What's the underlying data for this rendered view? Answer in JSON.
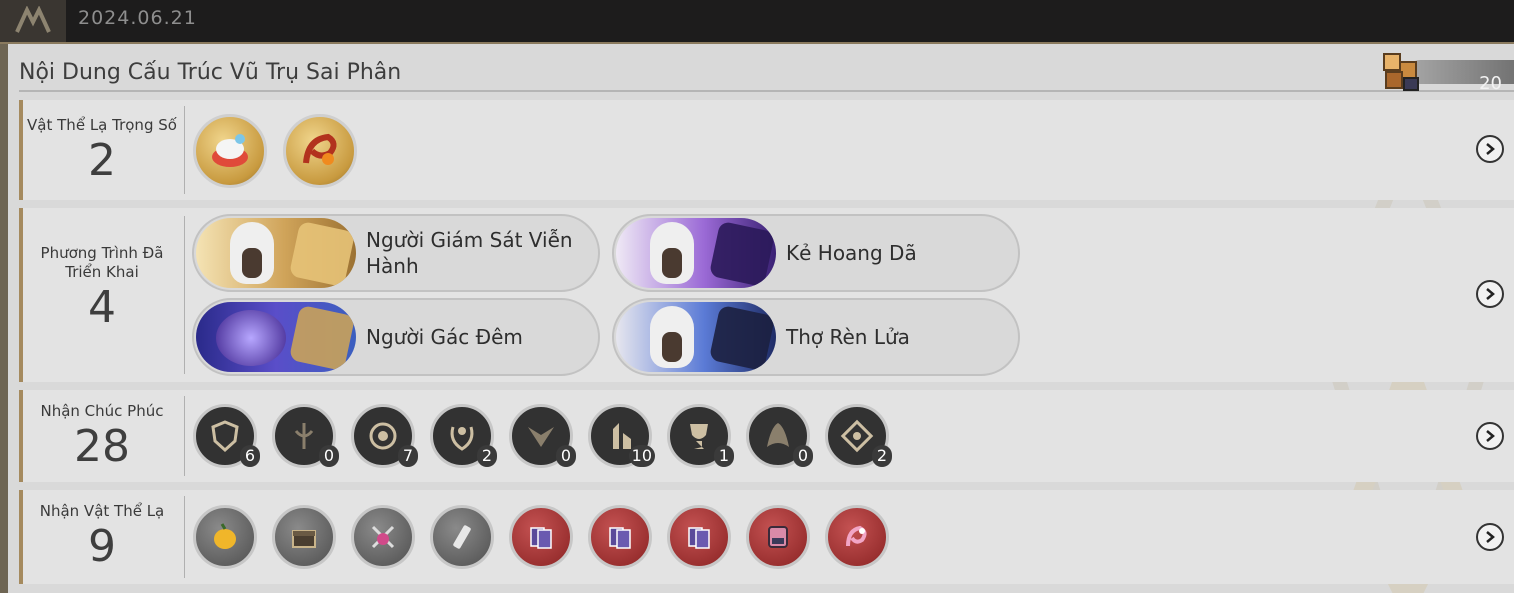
{
  "header": {
    "date": "2024.06.21"
  },
  "panel": {
    "title": "Nội Dung Cấu Trúc Vũ Trụ Sai Phân",
    "counter_value": "20",
    "counter_icon": "cube-currency-icon"
  },
  "sections": [
    {
      "label": "Vật Thể Lạ Trọng Số",
      "count": "2",
      "items": [
        {
          "icon": "chef-hat-curio-icon"
        },
        {
          "icon": "dragon-curio-icon"
        }
      ]
    },
    {
      "label": "Phương Trình Đã Triển Khai",
      "count": "4",
      "equations": [
        {
          "name": "Người Giám Sát Viễn Hành",
          "theme": "gold"
        },
        {
          "name": "Kẻ Hoang Dã",
          "theme": "purple"
        },
        {
          "name": "Người Gác Đêm",
          "theme": "blue"
        },
        {
          "name": "Thợ Rèn Lửa",
          "theme": "blue2"
        }
      ]
    },
    {
      "label": "Nhận Chúc Phúc",
      "count": "28",
      "blessings": [
        {
          "icon": "preservation-shield-icon",
          "count": "6"
        },
        {
          "icon": "remembrance-icon",
          "count": "0"
        },
        {
          "icon": "nihility-eye-icon",
          "count": "7"
        },
        {
          "icon": "abundance-laurel-icon",
          "count": "2"
        },
        {
          "icon": "hunt-icon",
          "count": "0"
        },
        {
          "icon": "destruction-icon",
          "count": "10"
        },
        {
          "icon": "elation-trophy-icon",
          "count": "1"
        },
        {
          "icon": "propagation-icon",
          "count": "0"
        },
        {
          "icon": "erudition-icon",
          "count": "2"
        }
      ]
    },
    {
      "label": "Nhận Vật Thể Lạ",
      "count": "9",
      "curios": [
        {
          "icon": "golden-fruit-icon",
          "rarity": "grey"
        },
        {
          "icon": "treasure-chest-icon",
          "rarity": "grey"
        },
        {
          "icon": "potion-sword-icon",
          "rarity": "grey"
        },
        {
          "icon": "paint-tube-icon",
          "rarity": "grey"
        },
        {
          "icon": "cards-icon",
          "rarity": "red"
        },
        {
          "icon": "cards-icon",
          "rarity": "red"
        },
        {
          "icon": "cards-icon",
          "rarity": "red"
        },
        {
          "icon": "pink-machine-icon",
          "rarity": "red"
        },
        {
          "icon": "pink-dragon-icon",
          "rarity": "red"
        }
      ]
    }
  ]
}
